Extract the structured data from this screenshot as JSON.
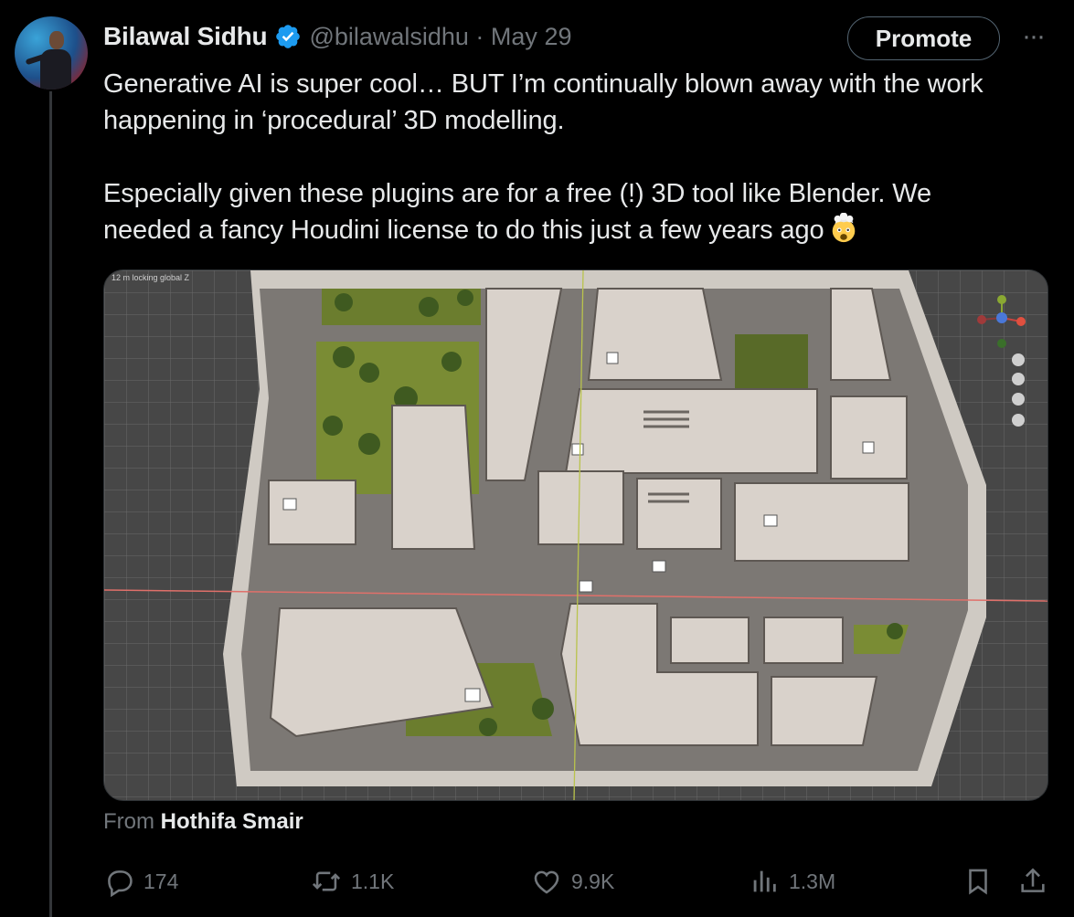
{
  "author": {
    "name": "Bilawal Sidhu",
    "handle_date": "@bilawalsidhu · May 29",
    "verified": true
  },
  "header_actions": {
    "promote_label": "Promote",
    "more_label": "···"
  },
  "tweet": {
    "line1": "Generative AI is super cool… BUT I’m continually blown away with the work",
    "line2": "happening in ‘procedural’ 3D modelling.",
    "line3": "Especially given these plugins are for a free (!) 3D tool like Blender. We",
    "line4": "needed a fancy Houdini license to do this just a few years ago",
    "emoji": "exploding-head"
  },
  "media": {
    "viewport_label": "12 m locking global Z",
    "gizmo_labels": [
      "Y",
      "Z",
      "X"
    ]
  },
  "source": {
    "prefix": "From",
    "name": "Hothifa Smair"
  },
  "actions": {
    "replies": "174",
    "reposts": "1.1K",
    "likes": "9.9K",
    "views": "1.3M"
  },
  "colors": {
    "background": "#000000",
    "text": "#e7e9ea",
    "secondary": "#71767b",
    "verified": "#1d9bf0"
  }
}
